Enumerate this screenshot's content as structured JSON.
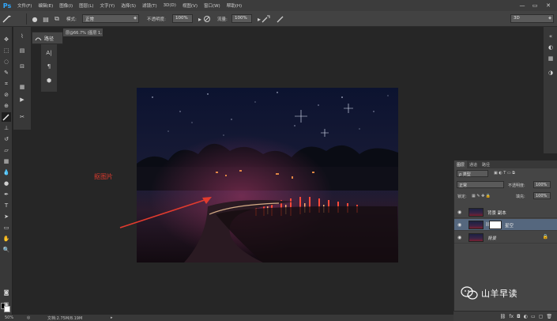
{
  "app": {
    "logo": "Ps",
    "accent": "#31a8ff"
  },
  "menu": [
    "文件(F)",
    "编辑(E)",
    "图像(I)",
    "图层(L)",
    "文字(Y)",
    "选择(S)",
    "滤镜(T)",
    "3D(D)",
    "视图(V)",
    "窗口(W)",
    "帮助(H)"
  ],
  "window_controls": {
    "minimize": "—",
    "maximize": "▭",
    "close": "✕"
  },
  "options": {
    "mode_label": "模式:",
    "mode_value": "正常",
    "opacity_label": "不透明度:",
    "opacity_value": "100%",
    "flow_label": "流量:",
    "flow_value": "100%",
    "workspace": "3D"
  },
  "doc_tab": "层@66.7% (图层 1, RGB/8) *",
  "path_panel_label": "路径",
  "annotation_text": "抠图片",
  "annotation_color": "#e23b2e",
  "layers_panel": {
    "tabs": [
      "图层",
      "通道",
      "路径"
    ],
    "filter_label": "ρ 类型",
    "blend_mode": "正常",
    "opacity_label": "不透明度:",
    "opacity_value": "100%",
    "lock_label": "锁定:",
    "fill_label": "填充:",
    "fill_value": "100%",
    "layers": [
      {
        "name": "背景 副本",
        "selected": false,
        "has_mask": false
      },
      {
        "name": "星空",
        "selected": true,
        "has_mask": true
      },
      {
        "name": "背景",
        "selected": false,
        "has_mask": false
      }
    ],
    "selected_color": "#55677e"
  },
  "watermark": "山羊早读",
  "status": {
    "zoom": "50%",
    "doc_info": "文档:2.75M/8.19M"
  }
}
